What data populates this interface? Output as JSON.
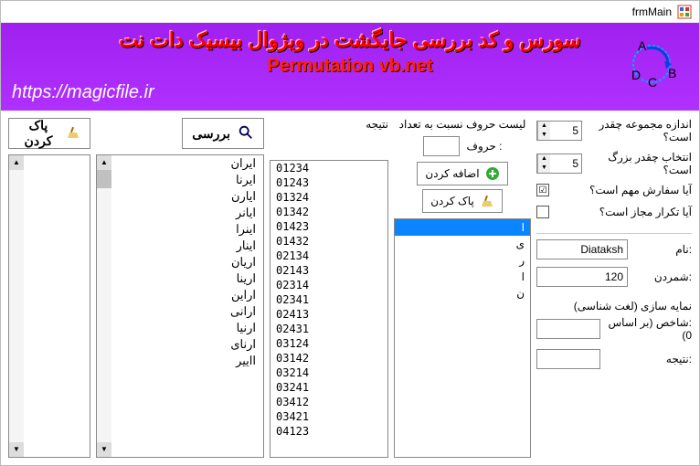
{
  "window": {
    "title": "frmMain"
  },
  "header": {
    "persian_title": "سورس و کد بررسی جایگشت در ویژوال بیسیک دات نت",
    "english_title": "Permutation vb.net",
    "url": "https://magicfile.ir"
  },
  "settings": {
    "set_size_label": "اندازه مجموعه چقدر است؟",
    "set_size_value": "5",
    "selection_label": "انتخاب چقدر بزرگ است؟",
    "selection_value": "5",
    "order_matters_label": "آیا سفارش مهم است؟",
    "order_matters_checked": "☑",
    "repeat_allowed_label": "آیا تکرار مجاز است؟",
    "repeat_allowed_checked": ""
  },
  "info": {
    "name_label": ":نام",
    "name_value": "Diataksh",
    "count_label": ":شمردن",
    "count_value": "120",
    "indexing_title": "نمایه سازی (لغت شناسی)",
    "index_label": ":شاخص (بر اساس 0)",
    "index_value": "",
    "result_label": ":نتیجه",
    "result_value": ""
  },
  "letters": {
    "title": "لیست حروف نسبت به تعداد",
    "input_label": ": حروف",
    "add_label": "اضافه کردن",
    "clear_label": "پاک کردن",
    "items": [
      "ا",
      "ی",
      "ر",
      "ا",
      "ن"
    ]
  },
  "result_col": {
    "title": "نتیجه",
    "items": [
      "01234",
      "01243",
      "01324",
      "01342",
      "01423",
      "01432",
      "02134",
      "02143",
      "02314",
      "02341",
      "02413",
      "02431",
      "03124",
      "03142",
      "03214",
      "03241",
      "03412",
      "03421",
      "04123"
    ]
  },
  "buttons": {
    "check": "بررسی",
    "clear_all": "پاک کردن"
  },
  "words": {
    "items": [
      "ایران",
      "ایرنا",
      "ایارن",
      "ایانر",
      "اینرا",
      "اینار",
      "اریان",
      "ارینا",
      "اراین",
      "ارانی",
      "ارنیا",
      "ارنای",
      "ااییر"
    ]
  }
}
